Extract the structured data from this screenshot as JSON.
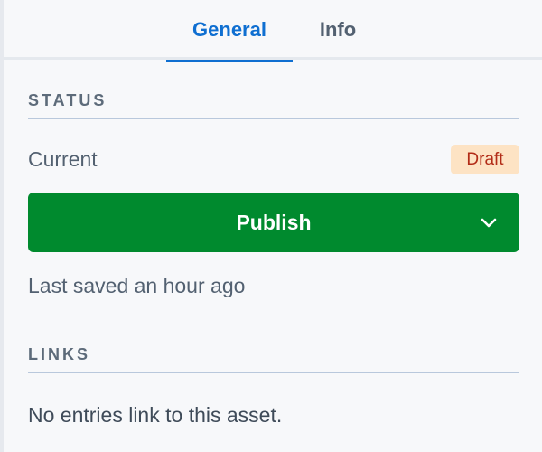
{
  "tabs": [
    {
      "label": "General",
      "active": true
    },
    {
      "label": "Info",
      "active": false
    }
  ],
  "status": {
    "heading": "STATUS",
    "current_label": "Current",
    "badge": "Draft",
    "publish_label": "Publish",
    "last_saved": "Last saved an hour ago"
  },
  "links": {
    "heading": "LINKS",
    "empty_text": "No entries link to this asset."
  },
  "colors": {
    "accent": "#0f6fd1",
    "publish": "#008a2e",
    "badge_bg": "#fde3c4",
    "badge_text": "#b22c17"
  },
  "icons": {
    "publish_dropdown": "chevron-down-icon"
  }
}
